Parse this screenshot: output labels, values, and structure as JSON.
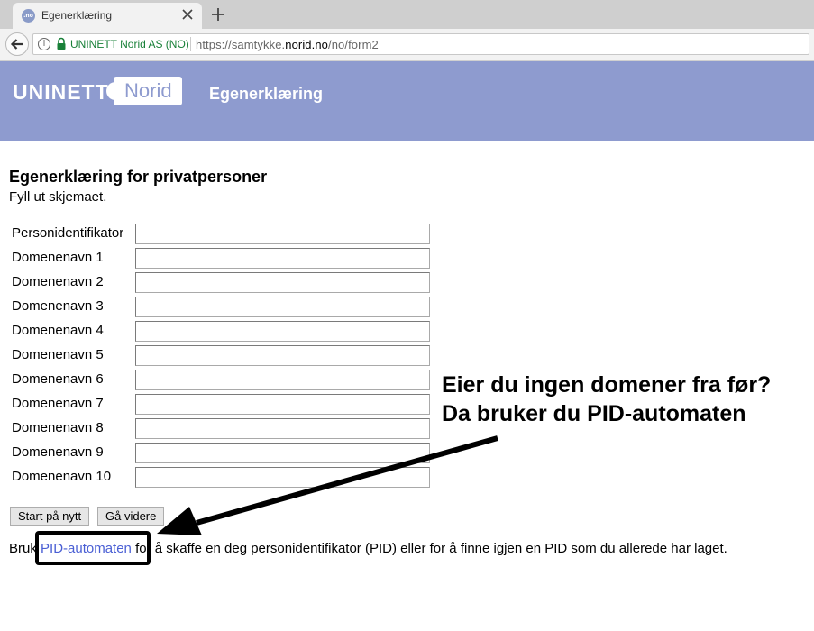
{
  "browser": {
    "tab_title": "Egenerklæring",
    "favicon_text": ".no",
    "site_identity": "UNINETT Norid AS (NO)",
    "url_prefix": "https://samtykke.",
    "url_domain": "norid.no",
    "url_path": "/no/form2"
  },
  "header": {
    "logo_uninett": "UNINETT",
    "logo_norid": "Norid",
    "title": "Egenerklæring",
    "background_color": "#8e9bcf"
  },
  "form": {
    "heading": "Egenerklæring for privatpersoner",
    "subheading": "Fyll ut skjemaet.",
    "fields": [
      {
        "label": "Personidentifikator",
        "value": ""
      },
      {
        "label": "Domenenavn 1",
        "value": ""
      },
      {
        "label": "Domenenavn 2",
        "value": ""
      },
      {
        "label": "Domenenavn 3",
        "value": ""
      },
      {
        "label": "Domenenavn 4",
        "value": ""
      },
      {
        "label": "Domenenavn 5",
        "value": ""
      },
      {
        "label": "Domenenavn 6",
        "value": ""
      },
      {
        "label": "Domenenavn 7",
        "value": ""
      },
      {
        "label": "Domenenavn 8",
        "value": ""
      },
      {
        "label": "Domenenavn 9",
        "value": ""
      },
      {
        "label": "Domenenavn 10",
        "value": ""
      }
    ],
    "restart_label": "Start på nytt",
    "next_label": "Gå videre"
  },
  "footer": {
    "prefix": "Bruk ",
    "link_text": "PID-automaten",
    "suffix": " for å skaffe en deg personidentifikator (PID) eller for å finne igjen en PID som du allerede har laget.",
    "link_color": "#4a5fd4"
  },
  "annotation": {
    "line1": "Eier du ingen domener fra før?",
    "line2": "Da bruker du PID-automaten"
  },
  "icons": [
    "back-arrow-icon",
    "info-icon",
    "lock-icon",
    "close-icon",
    "plus-icon"
  ]
}
